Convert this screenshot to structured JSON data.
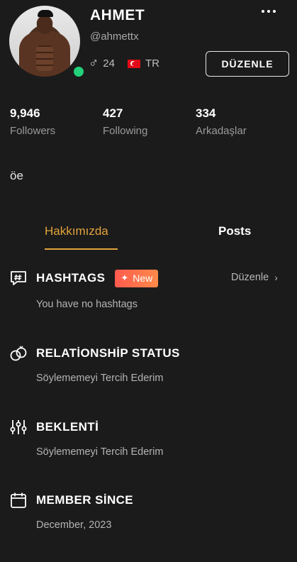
{
  "profile": {
    "name": "AHMET",
    "handle": "@ahmettx",
    "age": "24",
    "country": "TR",
    "edit_label": "DÜZENLE",
    "bio": "öe"
  },
  "stats": [
    {
      "value": "9,946",
      "label": "Followers"
    },
    {
      "value": "427",
      "label": "Following"
    },
    {
      "value": "334",
      "label": "Arkadaşlar"
    }
  ],
  "tabs": {
    "about": "Hakkımızda",
    "posts": "Posts"
  },
  "sections": {
    "hashtags": {
      "title": "HASHTAGS",
      "badge": "New",
      "edit_label": "Düzenle",
      "value": "You have no hashtags"
    },
    "relationship": {
      "title": "RELATİONSHİP STATUS",
      "value": "Söylememeyi Tercih Ederim"
    },
    "expectation": {
      "title": "BEKLENTİ",
      "value": "Söylememeyi Tercih Ederim"
    },
    "member_since": {
      "title": "MEMBER SİNCE",
      "value": "December, 2023"
    }
  },
  "icons": [
    "more-icon",
    "male-icon",
    "flag-tr-icon",
    "hashtag-chat-icon",
    "sparkle-icon",
    "chevron-right-icon",
    "rings-icon",
    "sliders-icon",
    "calendar-icon"
  ],
  "colors": {
    "background": "#1b1b1b",
    "accent": "#e2a33b",
    "online": "#22d17a",
    "badge_start": "#ff5a4e",
    "badge_end": "#ff8a4a"
  }
}
